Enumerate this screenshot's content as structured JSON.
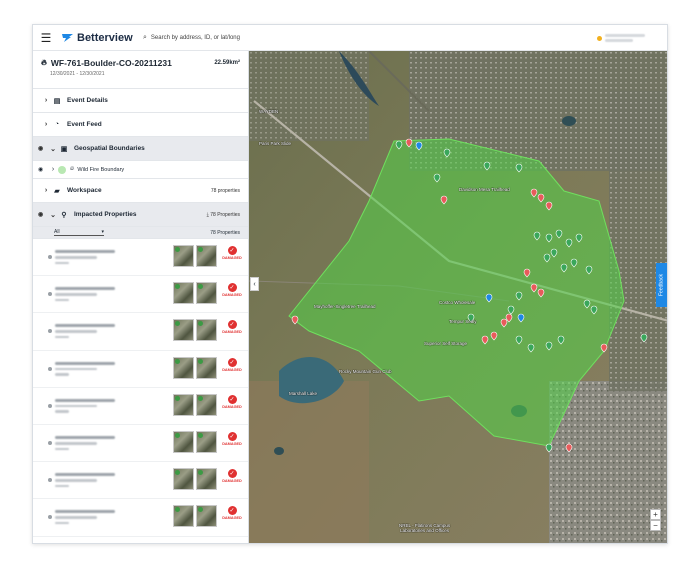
{
  "app": {
    "name": "Betterview"
  },
  "search": {
    "placeholder": "Search by address, ID, or lat/long"
  },
  "event": {
    "title": "WF-761-Boulder-CO-20211231",
    "area": "22.59km²",
    "dates": "12/30/2021 - 12/30/2021"
  },
  "sections": {
    "event_details": "Event Details",
    "event_feed": "Event Feed",
    "geospatial": "Geospatial Boundaries",
    "wildfire": "Wild Fire Boundary",
    "workspace": "Workspace",
    "workspace_count": "78 properties",
    "impacted": "Impacted Properties",
    "impacted_count": "78 Properties"
  },
  "filter": {
    "value": "All",
    "count": "78 Properties"
  },
  "damage_label": "DAMAGED",
  "map_labels": {
    "wayden": "WAYDEN",
    "park": "Paris Park Slide",
    "costco": "Costco Wholesale",
    "superior": "Superior Self Storage",
    "tempur": "Tempur Sealy",
    "davidson": "Davidson Mesa Trailhead",
    "maxwell": "Marshall Lake",
    "nrel": "NREL - Flatirons Campus\nLaboratories and Offices",
    "gun": "Rocky Mountain Gun Club",
    "mayhoffer": "Mayhoffer-Singletree Trailhead"
  },
  "feedback": "Feedback",
  "colors": {
    "accent": "#1e88e5",
    "fire_boundary": "#52d447",
    "damage": "#e03131"
  }
}
